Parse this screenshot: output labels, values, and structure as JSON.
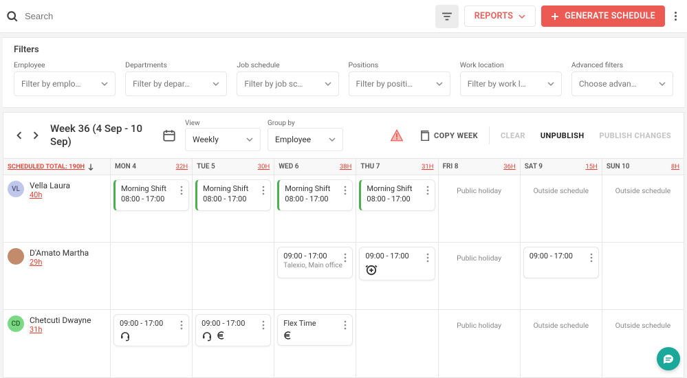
{
  "topbar": {
    "search_placeholder": "Search",
    "reports_label": "REPORTS",
    "generate_label": "GENERATE SCHEDULE"
  },
  "filters": {
    "title": "Filters",
    "items": [
      {
        "label": "Employee",
        "placeholder": "Filter by emplo…"
      },
      {
        "label": "Departments",
        "placeholder": "Filter by depar…"
      },
      {
        "label": "Job schedule",
        "placeholder": "Filter by job sc…"
      },
      {
        "label": "Positions",
        "placeholder": "Filter by positi…"
      },
      {
        "label": "Work location",
        "placeholder": "Filter by work l…"
      },
      {
        "label": "Advanced filters",
        "placeholder": "Choose advan…"
      }
    ]
  },
  "toolbar": {
    "week_title": "Week 36 (4 Sep - 10 Sep)",
    "view_label": "View",
    "view_value": "Weekly",
    "group_label": "Group by",
    "group_value": "Employee",
    "copy_week": "COPY WEEK",
    "clear": "CLEAR",
    "unpublish": "UNPUBLISH",
    "publish": "PUBLISH CHANGES"
  },
  "grid": {
    "total_label": "SCHEDULED TOTAL: 190H",
    "days": [
      {
        "label": "MON 4",
        "hours": "32H"
      },
      {
        "label": "TUE 5",
        "hours": "30H"
      },
      {
        "label": "WED 6",
        "hours": "38H"
      },
      {
        "label": "THU 7",
        "hours": "31H"
      },
      {
        "label": "FRI 8",
        "hours": "36H"
      },
      {
        "label": "SAT 9",
        "hours": "15H"
      },
      {
        "label": "SUN 10",
        "hours": "8H"
      }
    ],
    "employees": [
      {
        "name": "Vella Laura",
        "hours": "40h",
        "avatar_type": "initials",
        "avatar": "VL",
        "cells": [
          {
            "type": "shift",
            "title": "Morning Shift",
            "time": "08:00 - 17:00",
            "green": true
          },
          {
            "type": "shift",
            "title": "Morning Shift",
            "time": "08:00 - 17:00",
            "green": true
          },
          {
            "type": "shift",
            "title": "Morning Shift",
            "time": "08:00 - 17:00",
            "green": true
          },
          {
            "type": "shift",
            "title": "Morning Shift",
            "time": "08:00 - 17:00",
            "green": true
          },
          {
            "type": "note",
            "text": "Public holiday"
          },
          {
            "type": "note",
            "text": "Outside schedule"
          },
          {
            "type": "note",
            "text": "Outside schedule"
          }
        ]
      },
      {
        "name": "D'Amato Martha",
        "hours": "29h",
        "avatar_type": "image",
        "avatar": "",
        "cells": [
          {
            "type": "empty"
          },
          {
            "type": "empty"
          },
          {
            "type": "shift",
            "time": "09:00 - 17:00",
            "sub": "Talexio, Main office"
          },
          {
            "type": "shift",
            "time": "09:00 - 17:00",
            "icon": "alarm-add"
          },
          {
            "type": "note",
            "text": "Public holiday"
          },
          {
            "type": "shift",
            "time": "09:00 - 17:00"
          },
          {
            "type": "empty"
          }
        ]
      },
      {
        "name": "Chetcuti Dwayne",
        "hours": "31h",
        "avatar_type": "initials-green",
        "avatar": "CD",
        "cells": [
          {
            "type": "shift",
            "time": "09:00 - 17:00",
            "icons": [
              "headset"
            ]
          },
          {
            "type": "shift",
            "time": "09:00 - 17:00",
            "icons": [
              "headset",
              "euro"
            ]
          },
          {
            "type": "shift",
            "title": "Flex Time",
            "icons": [
              "euro"
            ]
          },
          {
            "type": "empty"
          },
          {
            "type": "note",
            "text": "Public holiday"
          },
          {
            "type": "note",
            "text": "Outside schedule"
          },
          {
            "type": "note",
            "text": "Outside schedule"
          }
        ]
      }
    ]
  }
}
